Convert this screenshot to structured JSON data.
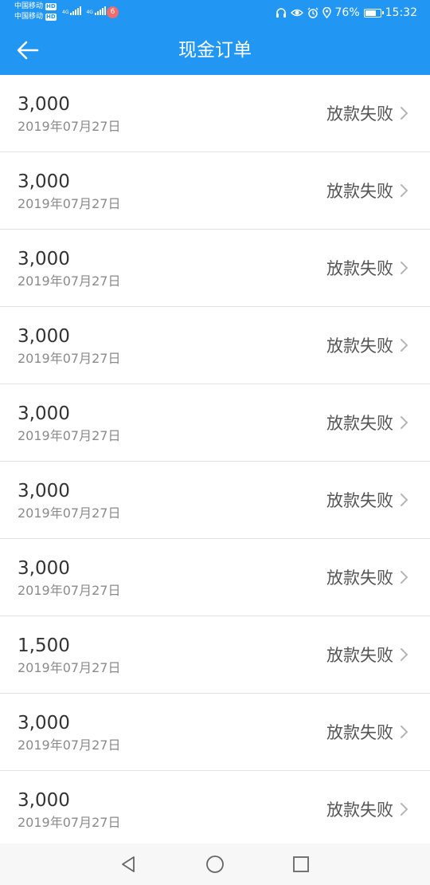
{
  "status_bar": {
    "carrier1": "中国移动",
    "carrier2": "中国移动",
    "hd": "HD",
    "network1": "4G",
    "network2": "4G",
    "app_badge": "6",
    "battery_percent": "76%",
    "battery_level": 0.76,
    "time": "15:32"
  },
  "header": {
    "title": "现金订单"
  },
  "orders": [
    {
      "amount": "3,000",
      "date": "2019年07月27日",
      "status": "放款失败"
    },
    {
      "amount": "3,000",
      "date": "2019年07月27日",
      "status": "放款失败"
    },
    {
      "amount": "3,000",
      "date": "2019年07月27日",
      "status": "放款失败"
    },
    {
      "amount": "3,000",
      "date": "2019年07月27日",
      "status": "放款失败"
    },
    {
      "amount": "3,000",
      "date": "2019年07月27日",
      "status": "放款失败"
    },
    {
      "amount": "3,000",
      "date": "2019年07月27日",
      "status": "放款失败"
    },
    {
      "amount": "3,000",
      "date": "2019年07月27日",
      "status": "放款失败"
    },
    {
      "amount": "1,500",
      "date": "2019年07月27日",
      "status": "放款失败"
    },
    {
      "amount": "3,000",
      "date": "2019年07月27日",
      "status": "放款失败"
    },
    {
      "amount": "3,000",
      "date": "2019年07月27日",
      "status": "放款失败"
    }
  ],
  "colors": {
    "primary": "#2196f3",
    "text": "#333333",
    "muted": "#8a8a8a",
    "divider": "#e0e0e0"
  },
  "icons": {
    "back": "arrow-left-icon",
    "chevron": "chevron-right-icon"
  }
}
